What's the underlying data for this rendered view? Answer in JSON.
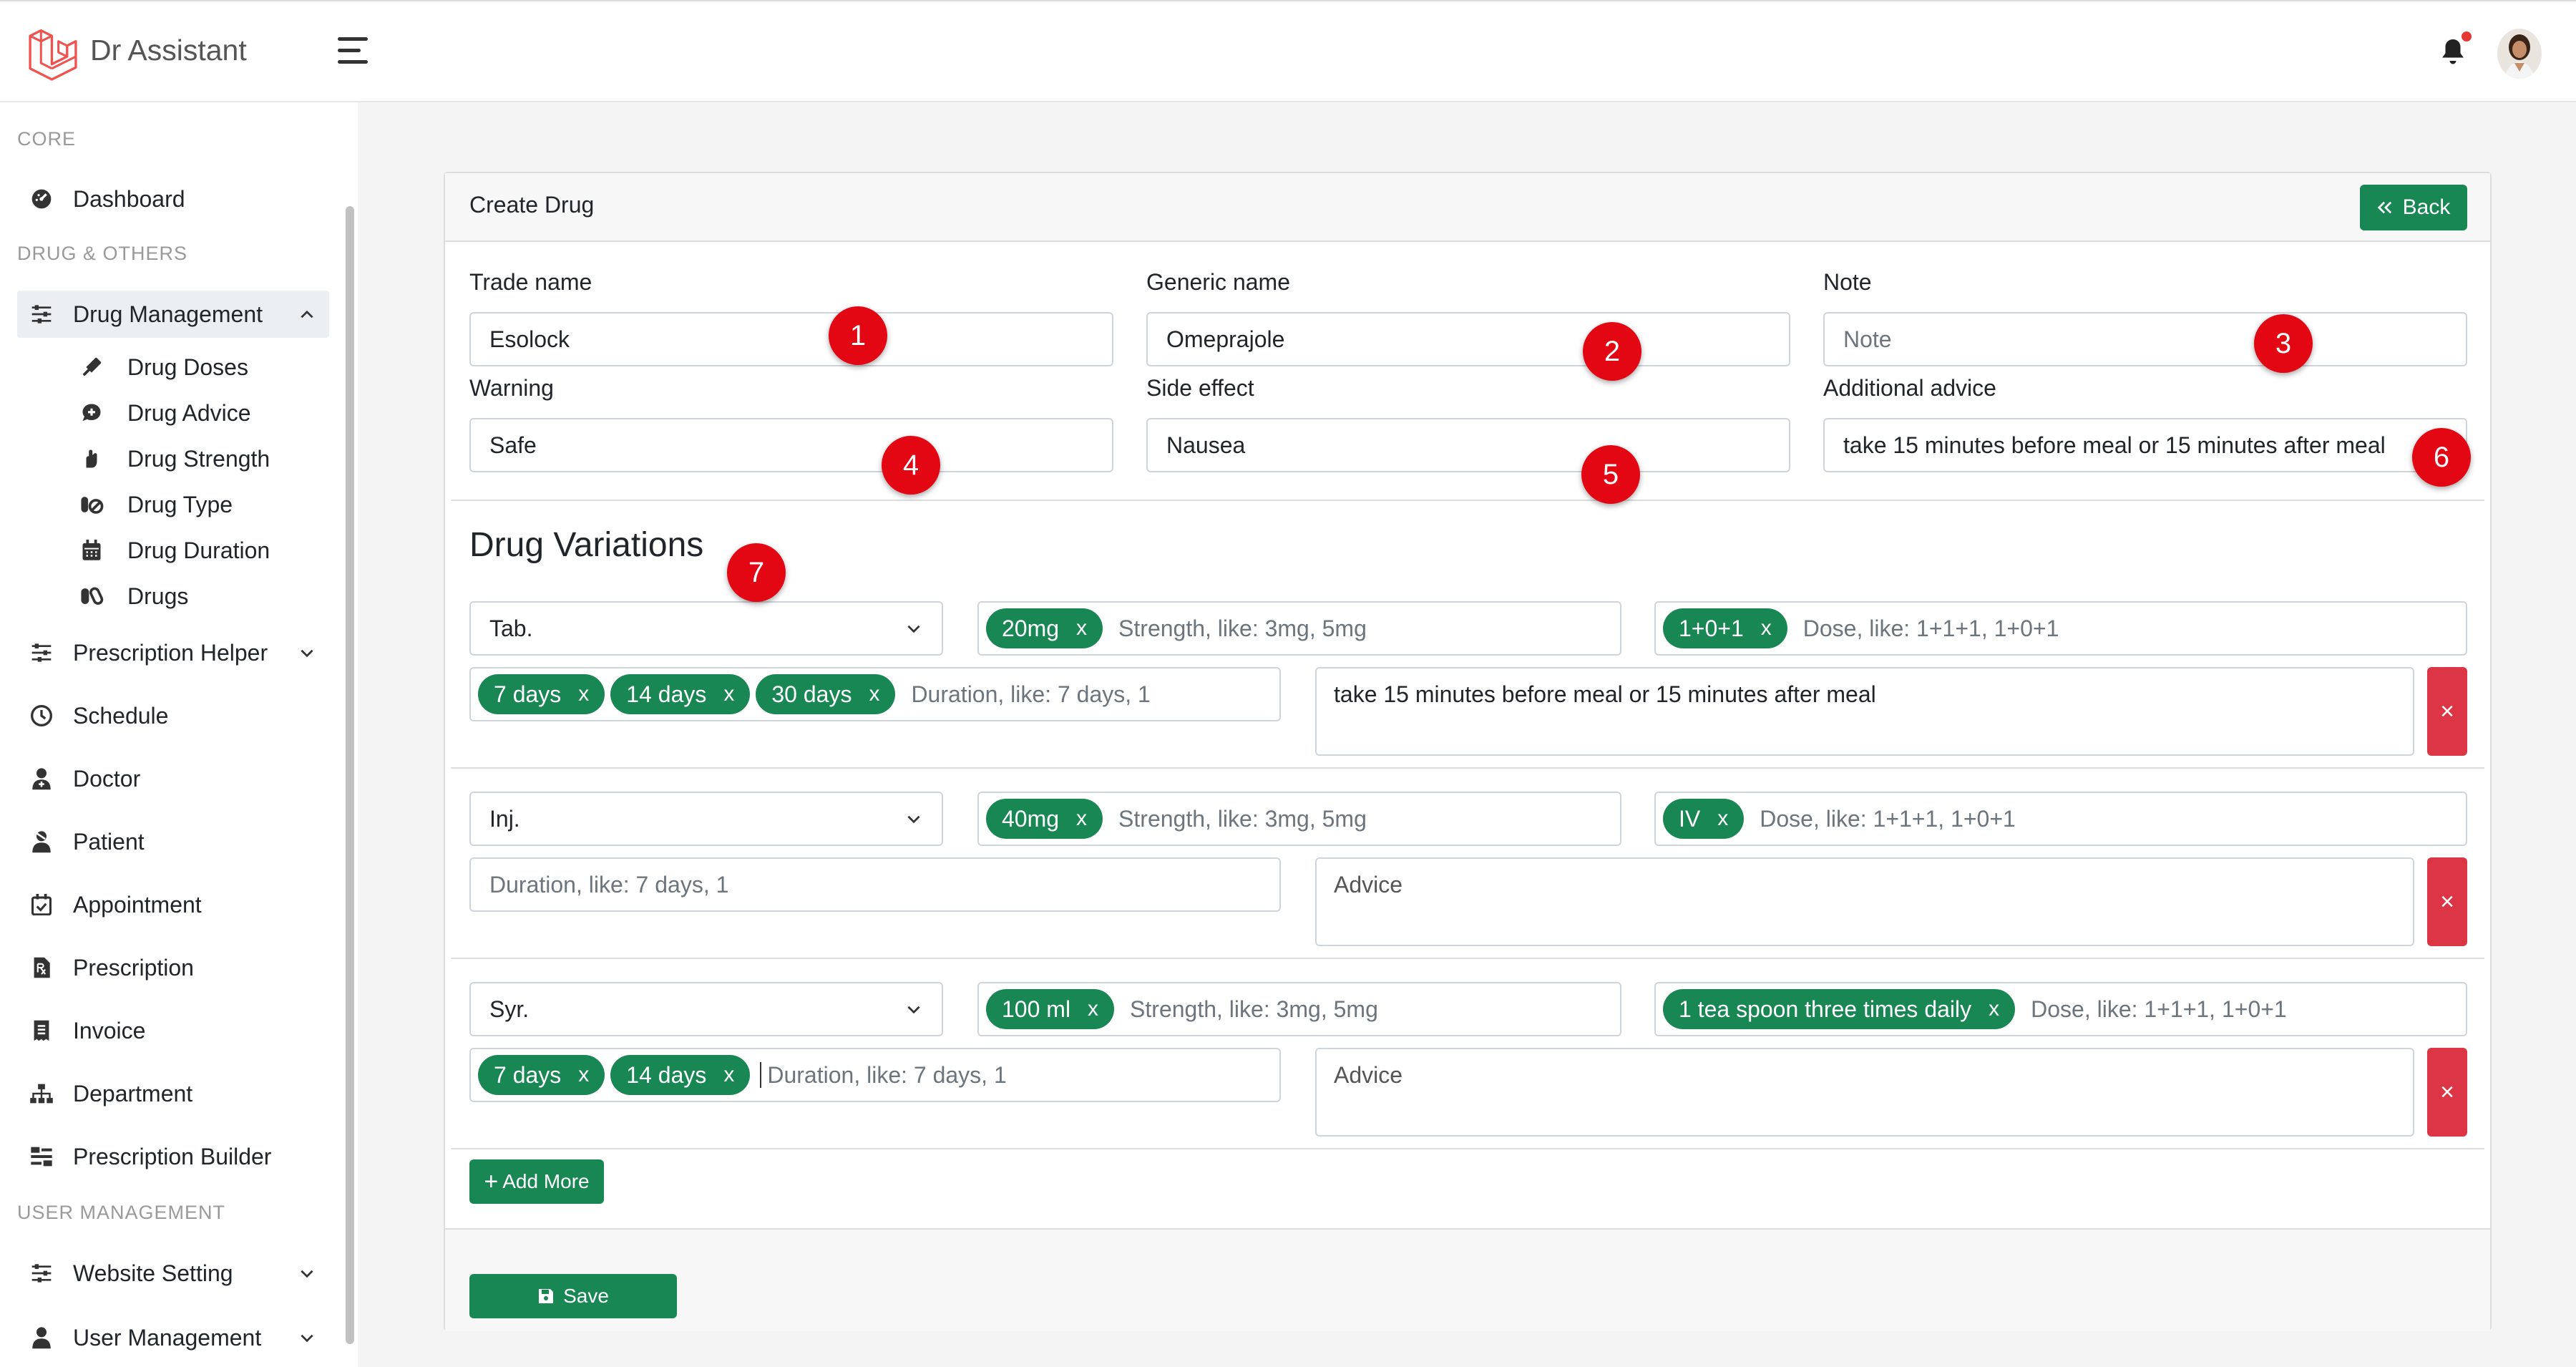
{
  "app": {
    "brand": "Dr Assistant",
    "accent": "#198754",
    "danger": "#dc3545"
  },
  "sidebar": {
    "sections": [
      "CORE",
      "DRUG & OTHERS",
      "USER MANAGEMENT"
    ],
    "items": [
      {
        "label": "Dashboard",
        "icon": "dashboard-icon"
      },
      {
        "label": "Drug Management",
        "icon": "sliders-icon",
        "expanded": true
      },
      {
        "label": "Prescription Helper",
        "icon": "sliders-icon"
      },
      {
        "label": "Schedule",
        "icon": "clock-icon"
      },
      {
        "label": "Doctor",
        "icon": "user-md-icon"
      },
      {
        "label": "Patient",
        "icon": "user-injured-icon"
      },
      {
        "label": "Appointment",
        "icon": "calendar-check-icon"
      },
      {
        "label": "Prescription",
        "icon": "file-prescription-icon"
      },
      {
        "label": "Invoice",
        "icon": "receipt-icon"
      },
      {
        "label": "Department",
        "icon": "sitemap-icon"
      },
      {
        "label": "Prescription Builder",
        "icon": "builder-icon"
      },
      {
        "label": "Website Setting",
        "icon": "sliders-icon"
      },
      {
        "label": "User Management",
        "icon": "user-icon"
      }
    ],
    "drug_submenu": [
      {
        "label": "Drug Doses",
        "icon": "syringe-icon"
      },
      {
        "label": "Drug Advice",
        "icon": "comment-medical-icon"
      },
      {
        "label": "Drug Strength",
        "icon": "hand-holding-medical-icon"
      },
      {
        "label": "Drug Type",
        "icon": "pills-icon"
      },
      {
        "label": "Drug Duration",
        "icon": "calendar-icon"
      },
      {
        "label": "Drugs",
        "icon": "capsules-icon"
      }
    ]
  },
  "card": {
    "title": "Create Drug",
    "back_label": "Back"
  },
  "form": {
    "trade_name": {
      "label": "Trade name",
      "value": "Esolock"
    },
    "generic_name": {
      "label": "Generic name",
      "value": "Omeprajole"
    },
    "note": {
      "label": "Note",
      "placeholder": "Note"
    },
    "warning": {
      "label": "Warning",
      "value": "Safe"
    },
    "side_effect": {
      "label": "Side effect",
      "value": "Nausea"
    },
    "additional_advice": {
      "label": "Additional advice",
      "value": "take 15 minutes before meal or 15 minutes after meal"
    }
  },
  "variations": {
    "heading": "Drug Variations",
    "strength_placeholder": "Strength, like: 3mg, 5mg",
    "dose_placeholder": "Dose, like: 1+1+1, 1+0+1",
    "duration_placeholder": "Duration, like: 7 days, 1",
    "advice_placeholder": "Advice",
    "rows": [
      {
        "type": "Tab.",
        "strength": [
          "20mg"
        ],
        "dose": [
          "1+0+1"
        ],
        "durations": [
          "7 days",
          "14 days",
          "30 days"
        ],
        "advice": "take 15 minutes before meal or 15 minutes after meal"
      },
      {
        "type": "Inj.",
        "strength": [
          "40mg"
        ],
        "dose": [
          "IV"
        ],
        "durations": [],
        "advice": ""
      },
      {
        "type": "Syr.",
        "strength": [
          "100 ml"
        ],
        "dose": [
          "1 tea spoon three times daily"
        ],
        "durations": [
          "7 days",
          "14 days"
        ],
        "advice": ""
      }
    ],
    "remove_label": "×",
    "tag_remove": "x"
  },
  "actions": {
    "add_more": "Add More",
    "save": "Save"
  },
  "markers": [
    "1",
    "2",
    "3",
    "4",
    "5",
    "6",
    "7"
  ]
}
